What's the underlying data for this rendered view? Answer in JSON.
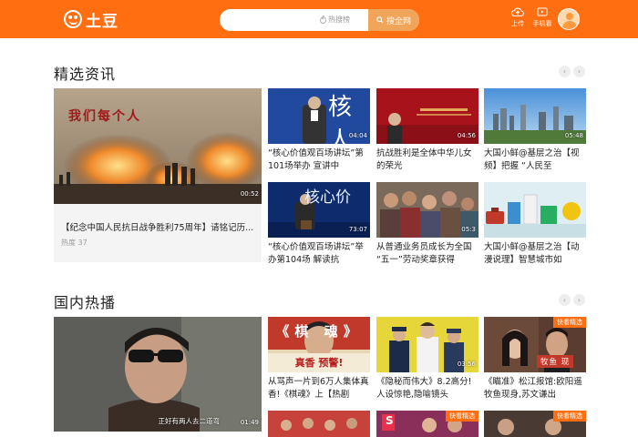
{
  "header": {
    "logo_text": "土豆",
    "search_placeholder": "",
    "hot_label": "热搜榜",
    "search_button": "搜全网",
    "upload_label": "上传",
    "mobile_label": "手机看"
  },
  "sections": [
    {
      "title": "精选资讯",
      "feature": {
        "caption": "【纪念中国人民抗日战争胜利75周年】请铭记历...",
        "meta": "热度 37",
        "duration": "00:52",
        "overlay_text": "我们每个人"
      },
      "cards": [
        {
          "caption": "“核心价值观百场讲坛”第101场举办 宣讲中",
          "duration": "04:04",
          "overlay_text": "核人"
        },
        {
          "caption": "抗战胜利是全体中华儿女的荣光",
          "duration": "04:56",
          "overlay_text": ""
        },
        {
          "caption": "大国小鲜@基层之治【视频】把握 “人民至",
          "duration": "05:48",
          "overlay_text": ""
        },
        {
          "caption": "“核心价值观百场讲坛”举办第104场 解读抗",
          "duration": "73:07",
          "overlay_text": "核心价"
        },
        {
          "caption": "从普通业务员成长为全国 “五一”劳动奖章获得",
          "duration": "05:3",
          "overlay_text": ""
        },
        {
          "caption": "大国小鲜@基层之治【动漫说理】智慧城市如",
          "duration": "",
          "overlay_text": ""
        }
      ]
    },
    {
      "title": "国内热播",
      "feature": {
        "duration": "01:49",
        "overlay_text": "正好有两人去二道弯"
      },
      "cards": [
        {
          "caption": "从骂声一片到6万人集体真香!《棋魂》上【热剧",
          "duration": "",
          "overlay_text": "《棋 魂》",
          "sub_text": "真香  预警!"
        },
        {
          "caption": "《隐秘而伟大》8.2高分!人设惊艳,隐喻镜头",
          "duration": "03:56",
          "overlay_text": ""
        },
        {
          "caption": "《瞄准》松江报馆:欧阳遥牧鱼现身,苏文谦出",
          "duration": "",
          "overlay_text": "牧鱼 现",
          "badge": "快看精选"
        }
      ]
    }
  ],
  "colors": {
    "brand_orange": "#ff6f12",
    "search_button": "#f0a55a"
  }
}
